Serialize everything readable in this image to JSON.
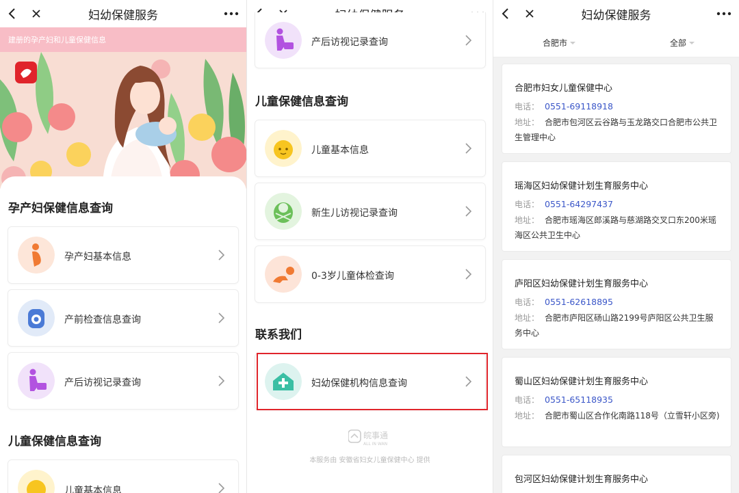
{
  "panels": [
    {
      "title": "妇幼保健服务"
    },
    {
      "title": "妇幼保健服务"
    },
    {
      "title": "妇幼保健服务"
    }
  ],
  "panel1": {
    "banner_text": "建册的孕产妇和儿童保健信息",
    "section_maternal": "孕产妇保健信息查询",
    "items": [
      {
        "label": "孕产妇基本信息",
        "icon": "pregnant-woman-icon"
      },
      {
        "label": "产前检查信息查询",
        "icon": "prenatal-exam-icon"
      },
      {
        "label": "产后访视记录查询",
        "icon": "postnatal-visit-icon"
      }
    ],
    "section_child": "儿童保健信息查询",
    "child_items": [
      {
        "label": "儿童基本信息",
        "icon": "child-face-icon"
      }
    ]
  },
  "panel2": {
    "top_item": {
      "label": "产后访视记录查询",
      "icon": "postnatal-visit-icon"
    },
    "section_child": "儿童保健信息查询",
    "items": [
      {
        "label": "儿童基本信息",
        "icon": "child-face-icon"
      },
      {
        "label": "新生儿访视记录查询",
        "icon": "newborn-icon"
      },
      {
        "label": "0-3岁儿童体检查询",
        "icon": "crawling-baby-icon"
      }
    ],
    "section_contact": "联系我们",
    "contact_item": {
      "label": "妇幼保健机构信息查询",
      "icon": "hospital-plus-icon"
    },
    "footer_logo_text": "皖事通",
    "footer_logo_sub": "ALL IN WAN",
    "footer_text": "本服务由 安徽省妇女儿童保健中心 提供"
  },
  "panel3": {
    "filter_city": "合肥市",
    "filter_all": "全部",
    "phone_label": "电话：",
    "addr_label": "地址：",
    "institutions": [
      {
        "name": "合肥市妇女儿童保健中心",
        "phone": "0551-69118918",
        "address": "合肥市包河区云谷路与玉龙路交口合肥市公共卫生管理中心"
      },
      {
        "name": "瑶海区妇幼保健计划生育服务中心",
        "phone": "0551-64297437",
        "address": "合肥市瑶海区郎溪路与慈湖路交叉口东200米瑶海区公共卫生中心"
      },
      {
        "name": "庐阳区妇幼保健计划生育服务中心",
        "phone": "0551-62618895",
        "address": "合肥市庐阳区砀山路2199号庐阳区公共卫生服务中心"
      },
      {
        "name": "蜀山区妇幼保健计划生育服务中心",
        "phone": "0551-65118935",
        "address": "合肥市蜀山区合作化南路118号（立雪轩小区旁)"
      },
      {
        "name": "包河区妇幼保健计划生育服务中心",
        "phone": "",
        "address": ""
      }
    ]
  }
}
